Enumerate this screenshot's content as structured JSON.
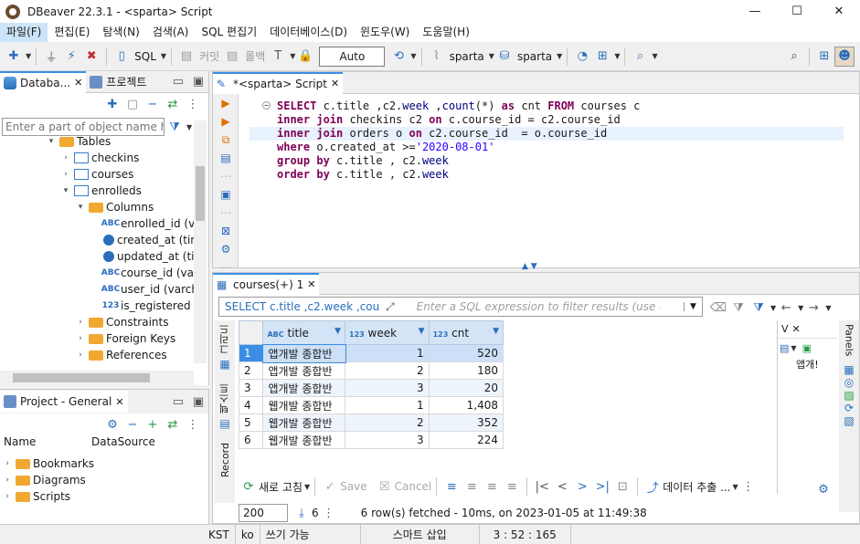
{
  "window": {
    "title": "DBeaver 22.3.1 - <sparta> Script",
    "min": "—",
    "max": "☐",
    "close": "✕"
  },
  "menu": [
    "파일(F)",
    "편집(E)",
    "탐색(N)",
    "검색(A)",
    "SQL 편집기",
    "데이터베이스(D)",
    "윈도우(W)",
    "도움말(H)"
  ],
  "toolbar": {
    "sql": "SQL",
    "commit": "커밋",
    "rollback": "롤백",
    "auto": "Auto",
    "connection": "sparta",
    "schema": "sparta"
  },
  "navigator": {
    "tab_db": "Databa...",
    "tab_project": "프로젝트",
    "filter_placeholder": "Enter a part of object name here",
    "tree": [
      {
        "label": "Tables",
        "icon": "folder",
        "indent": 50,
        "arrow": "▾"
      },
      {
        "label": "checkins",
        "icon": "table",
        "indent": 66,
        "arrow": "›"
      },
      {
        "label": "courses",
        "icon": "table",
        "indent": 66,
        "arrow": "›"
      },
      {
        "label": "enrolleds",
        "icon": "table",
        "indent": 66,
        "arrow": "▾"
      },
      {
        "label": "Columns",
        "icon": "folder",
        "indent": 82,
        "arrow": "▾"
      },
      {
        "label": "enrolled_id (va",
        "icon": "ABC",
        "indent": 98,
        "arrow": ""
      },
      {
        "label": "created_at (tim",
        "icon": "clock",
        "indent": 98,
        "arrow": ""
      },
      {
        "label": "updated_at (tir",
        "icon": "clock",
        "indent": 98,
        "arrow": ""
      },
      {
        "label": "course_id (varc",
        "icon": "ABC",
        "indent": 98,
        "arrow": ""
      },
      {
        "label": "user_id (varcha",
        "icon": "ABC",
        "indent": 98,
        "arrow": ""
      },
      {
        "label": "is_registered (t",
        "icon": "123",
        "indent": 98,
        "arrow": ""
      },
      {
        "label": "Constraints",
        "icon": "folder",
        "indent": 82,
        "arrow": "›"
      },
      {
        "label": "Foreign Keys",
        "icon": "folder",
        "indent": 82,
        "arrow": "›"
      },
      {
        "label": "References",
        "icon": "folder",
        "indent": 82,
        "arrow": "›"
      }
    ]
  },
  "project": {
    "tab": "Project - General",
    "col_name": "Name",
    "col_ds": "DataSource",
    "items": [
      "Bookmarks",
      "Diagrams",
      "Scripts"
    ]
  },
  "editor": {
    "tab": "*<sparta> Script",
    "lines": [
      [
        [
          "kw",
          "SELECT"
        ],
        [
          "t",
          " c.title ,c2."
        ],
        [
          "fn",
          "week"
        ],
        [
          "t",
          " ,"
        ],
        [
          "fn",
          "count"
        ],
        [
          "t",
          "(*) "
        ],
        [
          "kw",
          "as"
        ],
        [
          "t",
          " cnt "
        ],
        [
          "kw",
          "FROM"
        ],
        [
          "t",
          " courses c"
        ]
      ],
      [
        [
          "kw",
          "inner join"
        ],
        [
          "t",
          " checkins c2 "
        ],
        [
          "kw",
          "on"
        ],
        [
          "t",
          " c.course_id = c2.course_id"
        ]
      ],
      [
        [
          "kw",
          "inner join"
        ],
        [
          "t",
          " orders o "
        ],
        [
          "kw",
          "on"
        ],
        [
          "t",
          " c2.course_id  = o.course_id "
        ]
      ],
      [
        [
          "kw",
          "where"
        ],
        [
          "t",
          " o.created_at >="
        ],
        [
          "str",
          "'2020-08-01'"
        ]
      ],
      [
        [
          "kw",
          "group by"
        ],
        [
          "t",
          " c.title , c2."
        ],
        [
          "fn",
          "week"
        ]
      ],
      [
        [
          "kw",
          "order by"
        ],
        [
          "t",
          " c.title , c2."
        ],
        [
          "fn",
          "week"
        ]
      ]
    ]
  },
  "results": {
    "tab": "courses(+) 1",
    "filter_query": "SELECT c.title ,c2.week ,cou",
    "filter_placeholder": "Enter a SQL expression to filter results (use Ctrl+Spac",
    "columns": [
      {
        "type": "ABC",
        "name": "title"
      },
      {
        "type": "123",
        "name": "week"
      },
      {
        "type": "123",
        "name": "cnt"
      }
    ],
    "rows": [
      [
        "1",
        "앱개발 종합반",
        "1",
        "520"
      ],
      [
        "2",
        "앱개발 종합반",
        "2",
        "180"
      ],
      [
        "3",
        "앱개발 종합반",
        "3",
        "20"
      ],
      [
        "4",
        "웹개발 종합반",
        "1",
        "1,408"
      ],
      [
        "5",
        "웹개발 종합반",
        "2",
        "352"
      ],
      [
        "6",
        "웹개발 종합반",
        "3",
        "224"
      ]
    ],
    "side_grid": "그리드",
    "side_text": "텍스트",
    "side_record": "Record",
    "value_panel_tab": "V",
    "value_panel_text": "앱개!",
    "panels_label": "Panels",
    "refresh": "새로 고침",
    "save": "Save",
    "cancel": "Cancel",
    "export": "데이터 추출 ...",
    "fetch_size": "200",
    "row_count": "6",
    "status": "6 row(s) fetched - 10ms, on 2023-01-05 at 11:49:38"
  },
  "statusbar": {
    "tz": "KST",
    "locale": "ko",
    "mode": "쓰기 가능",
    "insert": "스마트 삽입",
    "position": "3 : 52 : 165"
  }
}
